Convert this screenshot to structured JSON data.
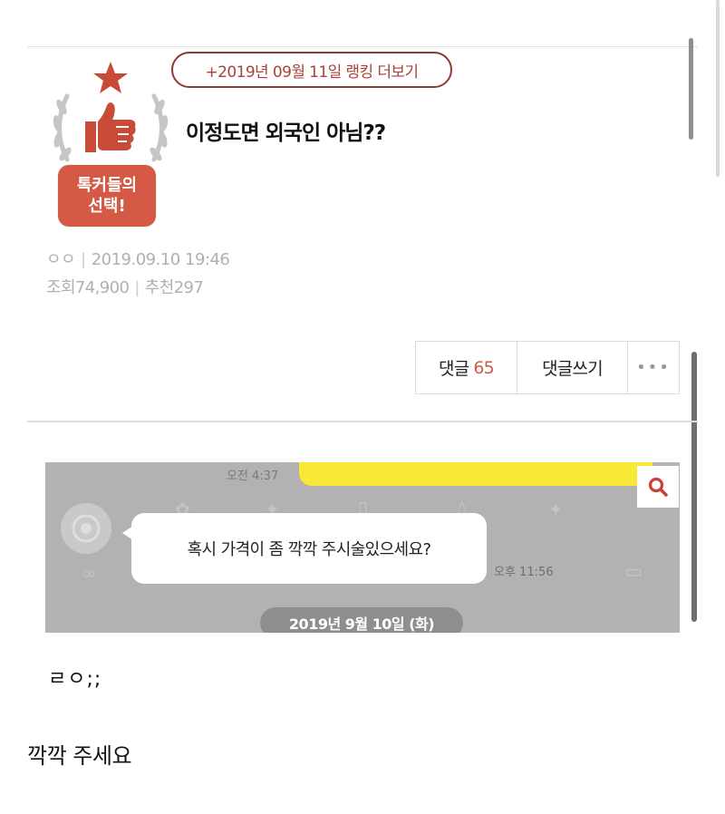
{
  "ranking": {
    "link_text": "+2019년 09월 11일 랭킹 더보기"
  },
  "badge": {
    "line1": "톡커들의",
    "line2": "선택!"
  },
  "post": {
    "title": "이정도면 외국인 아님??",
    "author": "ㅇㅇ",
    "datetime": "2019.09.10 19:46",
    "views_label": "조회",
    "views": "74,900",
    "recommend_label": "추천",
    "recommend": "297"
  },
  "actions": {
    "comment_label": "댓글",
    "comment_count": "65",
    "write_label": "댓글쓰기",
    "more_label": "•••"
  },
  "chat": {
    "time_top": "오전 4:37",
    "message": "혹시 가격이 좀 깍깍 주시술있으세요?",
    "time_bottom": "오후 11:56",
    "date": "2019년 9월 10일 (화)"
  },
  "body": {
    "line1": "ㄹㅇ;;",
    "line2": "깍깍 주세요"
  },
  "colors": {
    "accent": "#d45a45",
    "ranking_border": "#8a3b34",
    "chat_bg": "#b2b2b2",
    "chat_highlight": "#f7e936"
  }
}
